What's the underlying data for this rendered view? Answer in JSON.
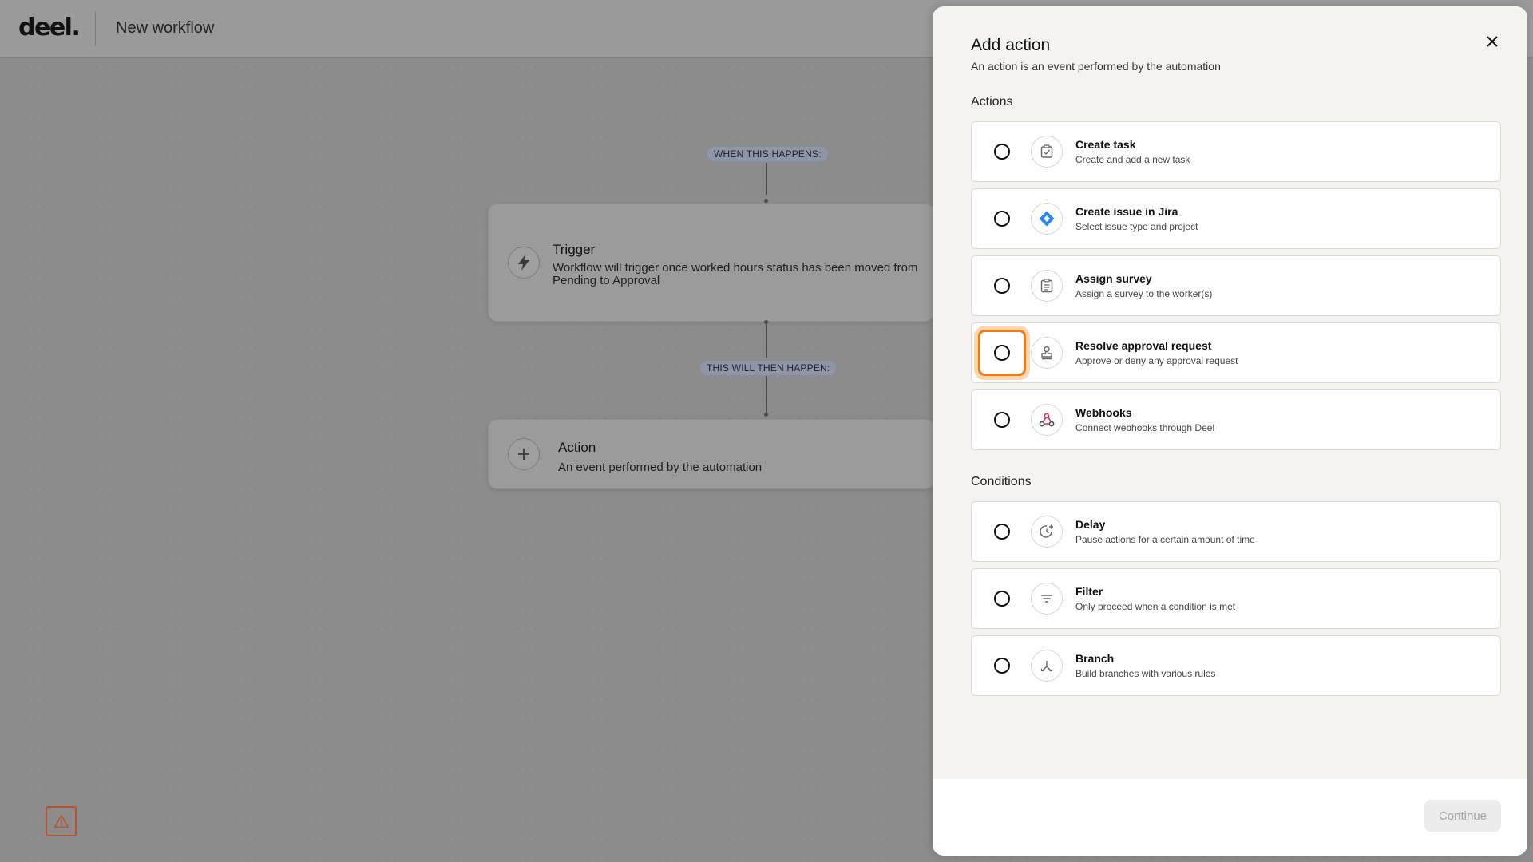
{
  "header": {
    "logo": "deel.",
    "title": "New workflow"
  },
  "canvas": {
    "when_label": "WHEN THIS HAPPENS:",
    "then_label": "THIS WILL THEN HAPPEN:",
    "trigger": {
      "icon": "lightning-icon",
      "title": "Trigger",
      "description": "Workflow will trigger once worked hours status has been moved from Pending to Approval"
    },
    "action": {
      "icon": "plus-icon",
      "title": "Action",
      "description": "An event performed by the automation"
    },
    "warning_icon": "warning-icon"
  },
  "drawer": {
    "title": "Add action",
    "subtitle": "An action is an event performed by the automation",
    "close_icon": "close-icon",
    "actions_label": "Actions",
    "actions": [
      {
        "title": "Create task",
        "description": "Create and add a new task",
        "icon": "task-check-icon"
      },
      {
        "title": "Create issue in Jira",
        "description": "Select issue type and project",
        "icon": "jira-icon"
      },
      {
        "title": "Assign survey",
        "description": "Assign a survey to the worker(s)",
        "icon": "clipboard-icon"
      },
      {
        "title": "Resolve approval request",
        "description": "Approve or deny any approval request",
        "icon": "stamp-icon",
        "focused": true
      },
      {
        "title": "Webhooks",
        "description": "Connect webhooks through Deel",
        "icon": "webhook-icon"
      }
    ],
    "conditions_label": "Conditions",
    "conditions": [
      {
        "title": "Delay",
        "description": "Pause actions for a certain amount of time",
        "icon": "clock-plus-icon"
      },
      {
        "title": "Filter",
        "description": "Only proceed when a condition is met",
        "icon": "filter-icon"
      },
      {
        "title": "Branch",
        "description": "Build branches with various rules",
        "icon": "branch-icon"
      }
    ],
    "continue_label": "Continue"
  },
  "colors": {
    "focus_ring": "#f07a14",
    "jira_blue": "#2684ff",
    "webhook_red": "#c73a5a"
  }
}
